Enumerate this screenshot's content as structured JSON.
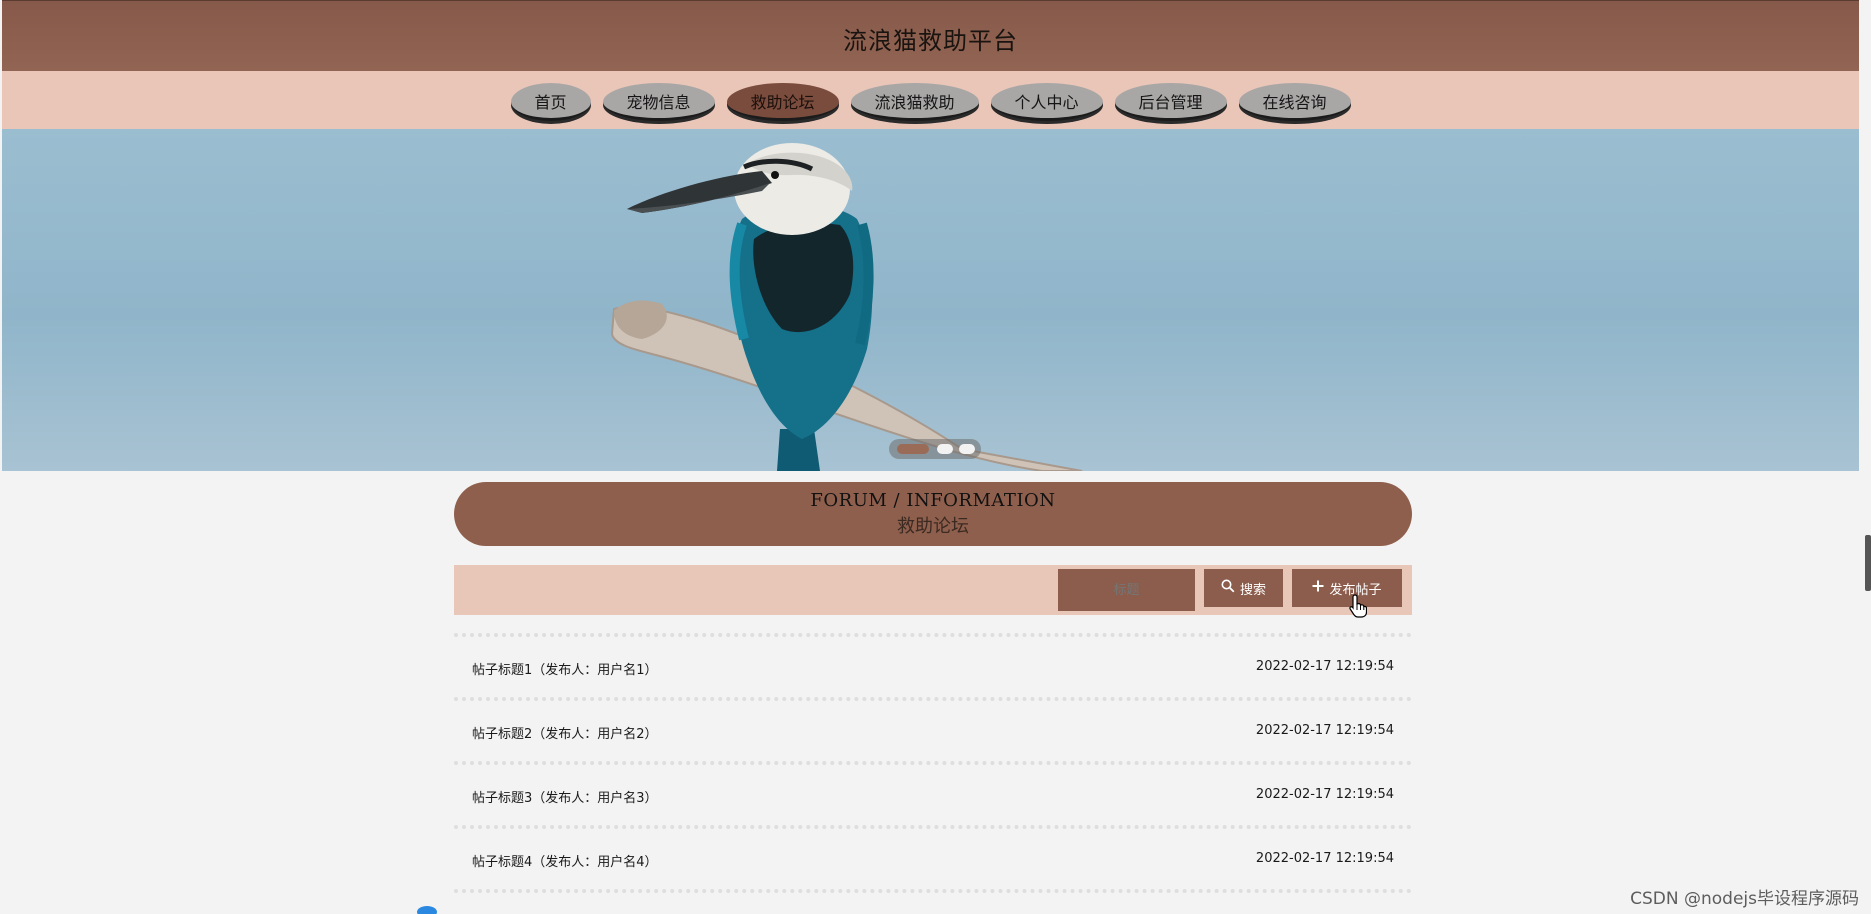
{
  "site": {
    "title": "流浪猫救助平台"
  },
  "nav": {
    "items": [
      {
        "label": "首页",
        "active": false
      },
      {
        "label": "宠物信息",
        "active": false
      },
      {
        "label": "救助论坛",
        "active": true
      },
      {
        "label": "流浪猫救助",
        "active": false
      },
      {
        "label": "个人中心",
        "active": false
      },
      {
        "label": "后台管理",
        "active": false
      },
      {
        "label": "在线咨询",
        "active": false
      }
    ]
  },
  "banner": {
    "slides": 3,
    "current": 1
  },
  "section": {
    "title_en": "FORUM / INFORMATION",
    "title_cn": "救助论坛"
  },
  "search": {
    "placeholder": "标题",
    "search_label": "搜索",
    "post_label": "发布帖子"
  },
  "posts": [
    {
      "title": "帖子标题1（发布人：用户名1）",
      "time": "2022-02-17 12:19:54"
    },
    {
      "title": "帖子标题2（发布人：用户名2）",
      "time": "2022-02-17 12:19:54"
    },
    {
      "title": "帖子标题3（发布人：用户名3）",
      "time": "2022-02-17 12:19:54"
    },
    {
      "title": "帖子标题4（发布人：用户名4）",
      "time": "2022-02-17 12:19:54"
    }
  ],
  "watermark": "CSDN @nodejs毕设程序源码",
  "colors": {
    "header": "#8c5e4d",
    "nav_bg": "#eac6b8",
    "accent": "#8c5d4c",
    "nav_pill": "#a9a7a6",
    "nav_active": "#7a4c3d"
  }
}
